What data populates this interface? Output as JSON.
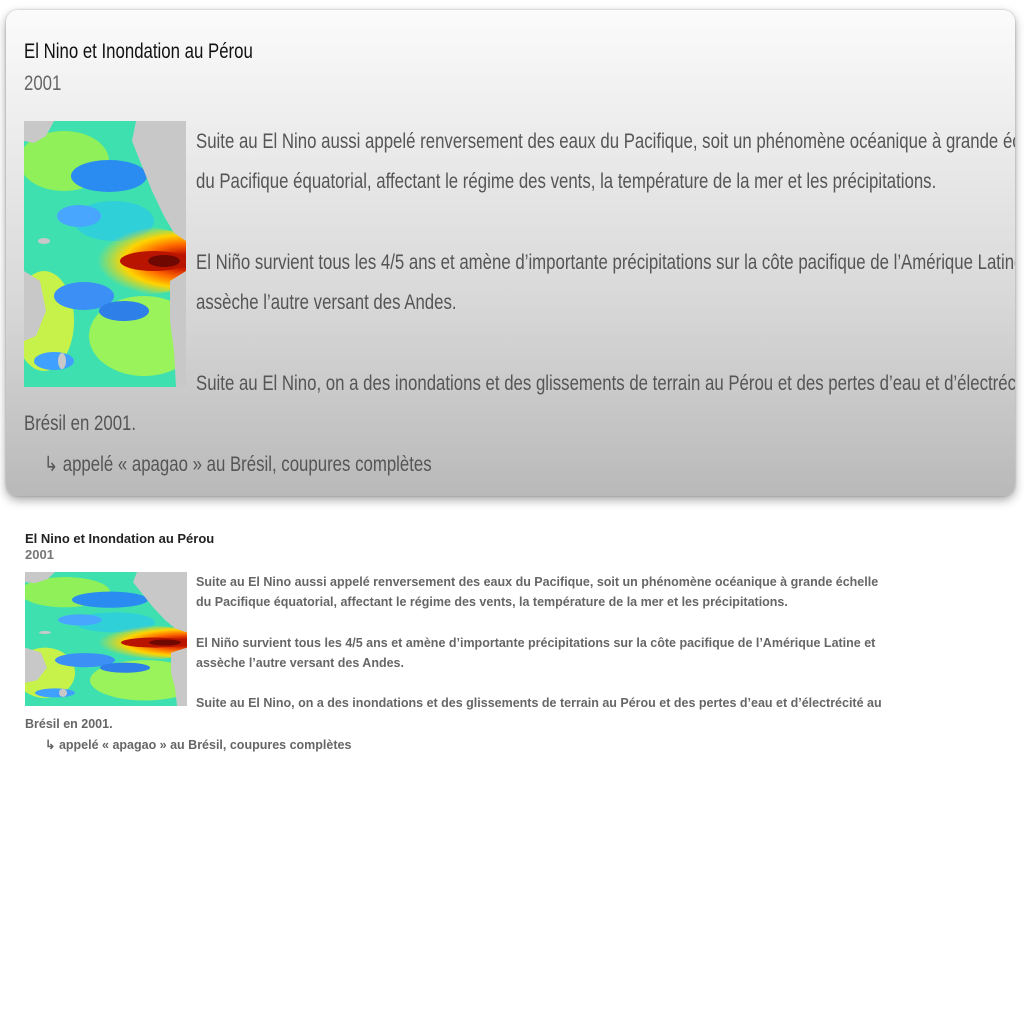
{
  "document": {
    "title": "El Nino et Inondation au Pérou",
    "year": "2001",
    "image_icon": "el-nino-sea-temperature-map",
    "paragraphs": {
      "p1_line1": "Suite au El Nino aussi appelé renversement des eaux du Pacifique, soit un phénomène océanique à grande échelle",
      "p1_line2": "du Pacifique équatorial, affectant le régime des vents, la température de la mer et les précipitations.",
      "p2_line1": "El Niño survient tous les 4/5 ans et amène d’importante précipitations sur la côte pacifique de l’Amérique Latine et",
      "p2_line2": "assèche l’autre versant des Andes.",
      "p3_line1": "Suite au El Nino, on a des inondations et des glissements de terrain au Pérou et des pertes d’eau et d’électrécité au",
      "p3_line2": "Brésil en 2001.",
      "sub_item": "↳ appelé « apagao » au Brésil, coupures complètes"
    }
  },
  "colors": {
    "title": "#111111",
    "year": "#666666",
    "body_text": "#555555",
    "ocean_cool": "#1e90ff",
    "ocean_warm": "#d62000",
    "land": "#c8c8c8"
  }
}
